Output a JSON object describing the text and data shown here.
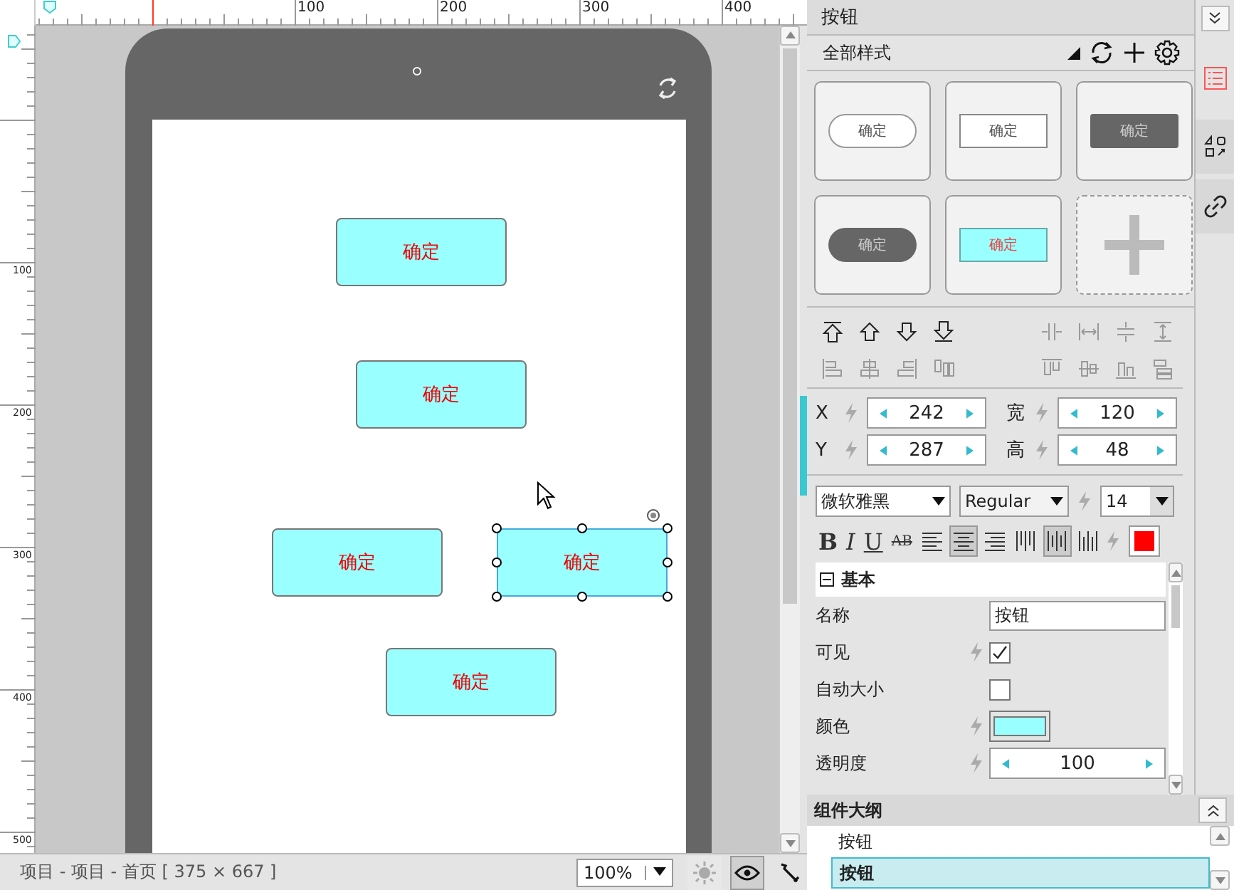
{
  "rulers": {
    "top_labels": [
      "100",
      "200",
      "300",
      "400"
    ],
    "left_labels": [
      "100",
      "200",
      "300",
      "400",
      "500"
    ]
  },
  "canvas": {
    "widgets": [
      {
        "label": "确定",
        "selected": false
      },
      {
        "label": "确定",
        "selected": false
      },
      {
        "label": "确定",
        "selected": false
      },
      {
        "label": "确定",
        "selected": true
      },
      {
        "label": "确定",
        "selected": false
      }
    ]
  },
  "status_bar": {
    "path": "项目 - 项目 - 首页 [ 375 × 667 ]",
    "zoom": "100%",
    "tools": [
      {
        "kind": "sun",
        "selected": false
      },
      {
        "kind": "eye",
        "selected": true
      },
      {
        "kind": "wrench",
        "selected": false
      }
    ]
  },
  "panel": {
    "title": "按钮",
    "style_filter": "全部样式",
    "styles": [
      {
        "kind": "pill",
        "label": "确定"
      },
      {
        "kind": "rect",
        "label": "确定"
      },
      {
        "kind": "dark-rect",
        "label": "确定"
      },
      {
        "kind": "dark-pill",
        "label": "确定"
      },
      {
        "kind": "cyan-rect",
        "label": "确定"
      },
      {
        "kind": "add"
      }
    ],
    "side_tabs": [
      {
        "kind": "list",
        "selected": true
      },
      {
        "kind": "shapes",
        "selected": false
      },
      {
        "kind": "link",
        "selected": false
      }
    ],
    "geometry": [
      {
        "label": "X",
        "value": "242"
      },
      {
        "label": "宽",
        "value": "120"
      },
      {
        "label": "Y",
        "value": "287"
      },
      {
        "label": "高",
        "value": "48"
      }
    ],
    "font": {
      "family": "微软雅黑",
      "style": "Regular",
      "size": "14"
    },
    "format_buttons": [
      {
        "label": "B",
        "kind": "bold"
      },
      {
        "label": "I",
        "kind": "italic"
      },
      {
        "label": "U",
        "kind": "underline"
      },
      {
        "label": "AB",
        "kind": "strike"
      }
    ],
    "text_align": [
      {
        "kind": "left",
        "selected": false
      },
      {
        "kind": "center",
        "selected": true
      },
      {
        "kind": "right",
        "selected": false
      }
    ],
    "vertical_align": [
      {
        "kind": "top",
        "selected": false
      },
      {
        "kind": "middle",
        "selected": true
      },
      {
        "kind": "bottom",
        "selected": false
      }
    ],
    "section": {
      "title": "基本",
      "expanded": true
    },
    "properties": [
      {
        "label": "名称",
        "kind": "text",
        "value": "按钮",
        "bindable": false
      },
      {
        "label": "可见",
        "kind": "checkbox",
        "checked": true,
        "bindable": true
      },
      {
        "label": "自动大小",
        "kind": "checkbox",
        "checked": false,
        "bindable": false
      },
      {
        "label": "颜色",
        "kind": "color",
        "color": "#99ffff",
        "bindable": true
      },
      {
        "label": "透明度",
        "kind": "spinner",
        "value": "100",
        "bindable": true
      }
    ],
    "outline": {
      "title": "组件大纲",
      "items": [
        {
          "label": "按钮",
          "selected": false
        },
        {
          "label": "按钮",
          "selected": true
        }
      ]
    }
  }
}
